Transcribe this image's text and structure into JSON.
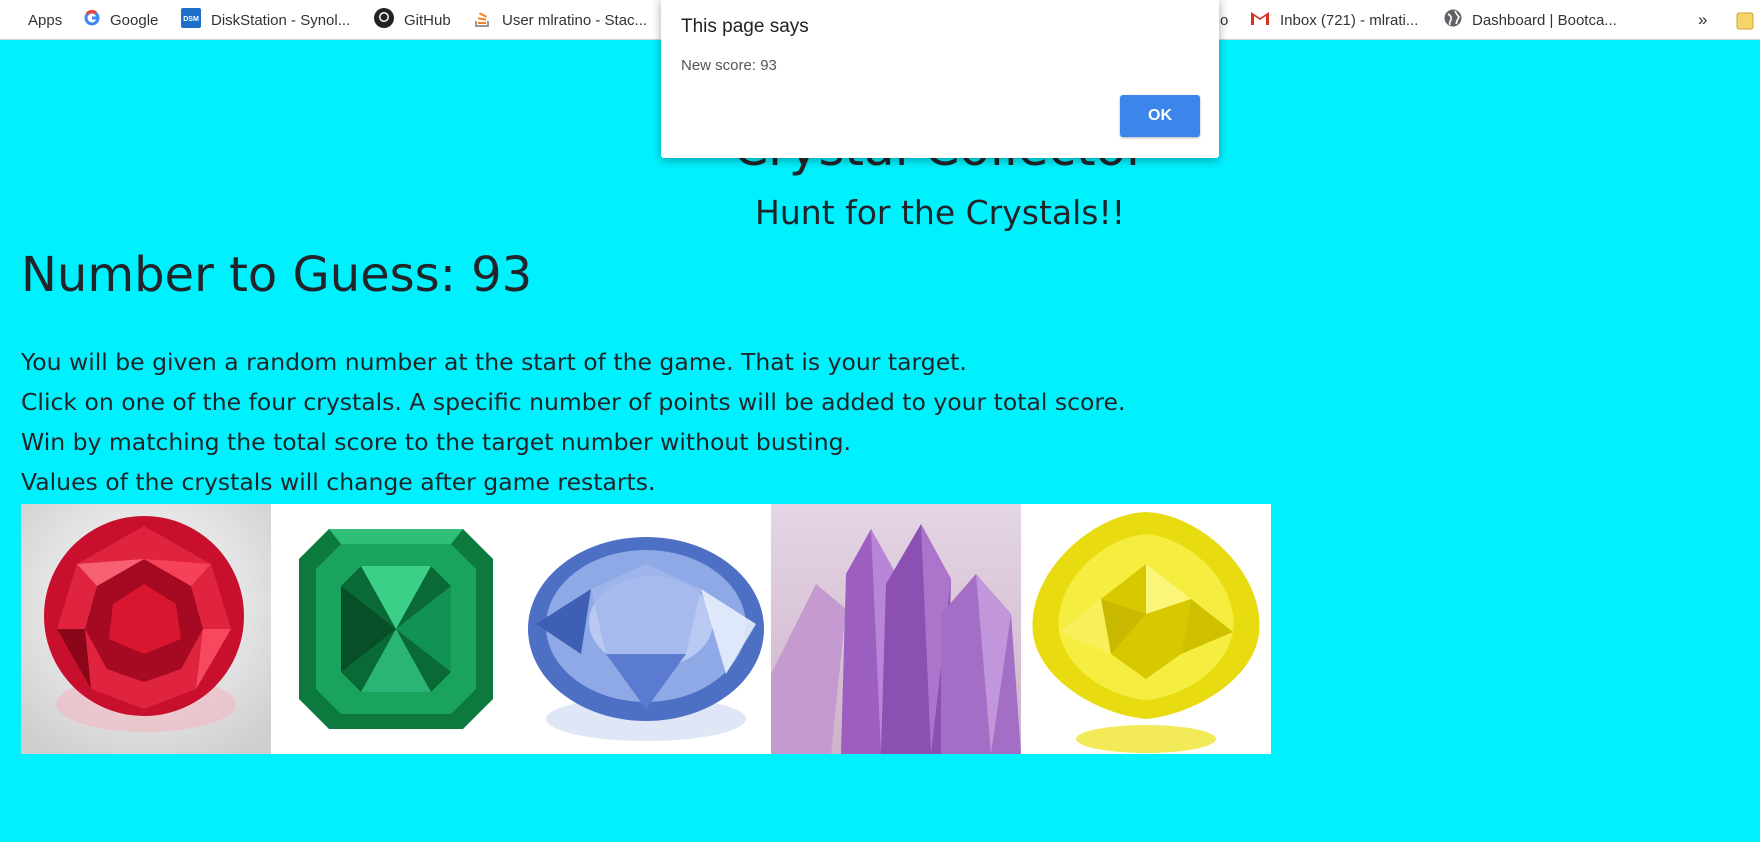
{
  "bookmarks": {
    "items": [
      {
        "label": "Apps",
        "icon": "apps-grid-icon"
      },
      {
        "label": "Google",
        "icon": "google-icon"
      },
      {
        "label": "DiskStation - Synol...",
        "icon": "dsm-icon"
      },
      {
        "label": "GitHub",
        "icon": "github-icon"
      },
      {
        "label": "User mlratino - Stac...",
        "icon": "stackoverflow-icon"
      },
      {
        "label": "o",
        "icon": ""
      },
      {
        "label": "Inbox (721) - mlrati...",
        "icon": "gmail-icon"
      },
      {
        "label": "Dashboard | Bootca...",
        "icon": "globe-icon"
      }
    ],
    "overflow": "»"
  },
  "game": {
    "title": "Crystal Collector",
    "subtitle": "Hunt for the Crystals!!",
    "target_label": "Number to Guess: 93",
    "instructions": [
      "You will be given a random number at the start of the game. That is your target.",
      "Click on one of the four crystals. A specific number of points will be added to your total score.",
      "Win by matching the total score to the target number without busting.",
      "Values of the crystals will change after game restarts."
    ],
    "crystals": [
      {
        "name": "ruby",
        "color": "#d8122e"
      },
      {
        "name": "emerald",
        "color": "#0e8a4a"
      },
      {
        "name": "sapphire",
        "color": "#6e8fd8"
      },
      {
        "name": "amethyst",
        "color": "#9a62b8"
      },
      {
        "name": "yellow-diamond",
        "color": "#f0e020"
      }
    ]
  },
  "dialog": {
    "title": "This page says",
    "message": "New score: 93",
    "ok_label": "OK"
  },
  "colors": {
    "page_background": "#00f1fe",
    "ok_button": "#3c86eb"
  }
}
